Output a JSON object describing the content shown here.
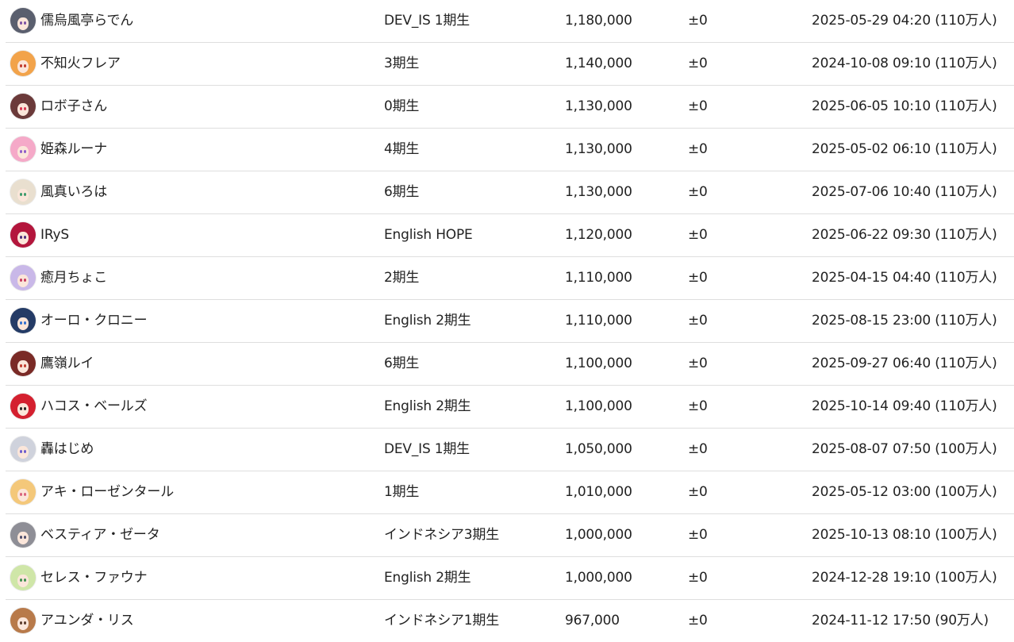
{
  "rows": [
    {
      "name": "儒烏風亭らでん",
      "generation": "DEV_IS 1期生",
      "subscribers": "1,180,000",
      "change": "±0",
      "reached": "2025-05-29 04:20 (110万人)",
      "avatar_icon": "raden-avatar-icon",
      "avatar_color": "#5a5f6e",
      "eye_color": "#7a4fa3"
    },
    {
      "name": "不知火フレア",
      "generation": "3期生",
      "subscribers": "1,140,000",
      "change": "±0",
      "reached": "2024-10-08 09:10 (110万人)",
      "avatar_icon": "flare-avatar-icon",
      "avatar_color": "#f2a34a",
      "eye_color": "#c0392b"
    },
    {
      "name": "ロボ子さん",
      "generation": "0期生",
      "subscribers": "1,130,000",
      "change": "±0",
      "reached": "2025-06-05 10:10 (110万人)",
      "avatar_icon": "roboco-avatar-icon",
      "avatar_color": "#6b3a3a",
      "eye_color": "#d8344f"
    },
    {
      "name": "姫森ルーナ",
      "generation": "4期生",
      "subscribers": "1,130,000",
      "change": "±0",
      "reached": "2025-05-02 06:10 (110万人)",
      "avatar_icon": "luna-avatar-icon",
      "avatar_color": "#f5a9c8",
      "eye_color": "#8e5bc9"
    },
    {
      "name": "風真いろは",
      "generation": "6期生",
      "subscribers": "1,130,000",
      "change": "±0",
      "reached": "2025-07-06 10:40 (110万人)",
      "avatar_icon": "iroha-avatar-icon",
      "avatar_color": "#e9dfcf",
      "eye_color": "#3a9a6a"
    },
    {
      "name": "IRyS",
      "generation": "English HOPE",
      "subscribers": "1,120,000",
      "change": "±0",
      "reached": "2025-06-22 09:30 (110万人)",
      "avatar_icon": "irys-avatar-icon",
      "avatar_color": "#b3163c",
      "eye_color": "#4a2a7a"
    },
    {
      "name": "癒月ちょこ",
      "generation": "2期生",
      "subscribers": "1,110,000",
      "change": "±0",
      "reached": "2025-04-15 04:40 (110万人)",
      "avatar_icon": "choco-avatar-icon",
      "avatar_color": "#c9b8e8",
      "eye_color": "#c7395c"
    },
    {
      "name": "オーロ・クロニー",
      "generation": "English 2期生",
      "subscribers": "1,110,000",
      "change": "±0",
      "reached": "2025-08-15 23:00 (110万人)",
      "avatar_icon": "kronii-avatar-icon",
      "avatar_color": "#243b66",
      "eye_color": "#2e6fd1"
    },
    {
      "name": "鷹嶺ルイ",
      "generation": "6期生",
      "subscribers": "1,100,000",
      "change": "±0",
      "reached": "2025-09-27 06:40 (110万人)",
      "avatar_icon": "lui-avatar-icon",
      "avatar_color": "#7a2a26",
      "eye_color": "#c0392b"
    },
    {
      "name": "ハコス・ベールズ",
      "generation": "English 2期生",
      "subscribers": "1,100,000",
      "change": "±0",
      "reached": "2025-10-14 09:40 (110万人)",
      "avatar_icon": "baelz-avatar-icon",
      "avatar_color": "#d4202f",
      "eye_color": "#222222"
    },
    {
      "name": "轟はじめ",
      "generation": "DEV_IS 1期生",
      "subscribers": "1,050,000",
      "change": "±0",
      "reached": "2025-08-07 07:50 (100万人)",
      "avatar_icon": "hajime-avatar-icon",
      "avatar_color": "#cfd2dc",
      "eye_color": "#6a5acd"
    },
    {
      "name": "アキ・ローゼンタール",
      "generation": "1期生",
      "subscribers": "1,010,000",
      "change": "±0",
      "reached": "2025-05-12 03:00 (100万人)",
      "avatar_icon": "aki-avatar-icon",
      "avatar_color": "#f4c87a",
      "eye_color": "#d9607a"
    },
    {
      "name": "ベスティア・ゼータ",
      "generation": "インドネシア3期生",
      "subscribers": "1,000,000",
      "change": "±0",
      "reached": "2025-10-13 08:10 (100万人)",
      "avatar_icon": "zeta-avatar-icon",
      "avatar_color": "#8e8e96",
      "eye_color": "#4a4a6a"
    },
    {
      "name": "セレス・ファウナ",
      "generation": "English 2期生",
      "subscribers": "1,000,000",
      "change": "±0",
      "reached": "2024-12-28 19:10 (100万人)",
      "avatar_icon": "fauna-avatar-icon",
      "avatar_color": "#cfe6a8",
      "eye_color": "#3f8f4f"
    },
    {
      "name": "アユンダ・リス",
      "generation": "インドネシア1期生",
      "subscribers": "967,000",
      "change": "±0",
      "reached": "2024-11-12 17:50 (90万人)",
      "avatar_icon": "risu-avatar-icon",
      "avatar_color": "#b87a4a",
      "eye_color": "#5a3a2a"
    }
  ]
}
